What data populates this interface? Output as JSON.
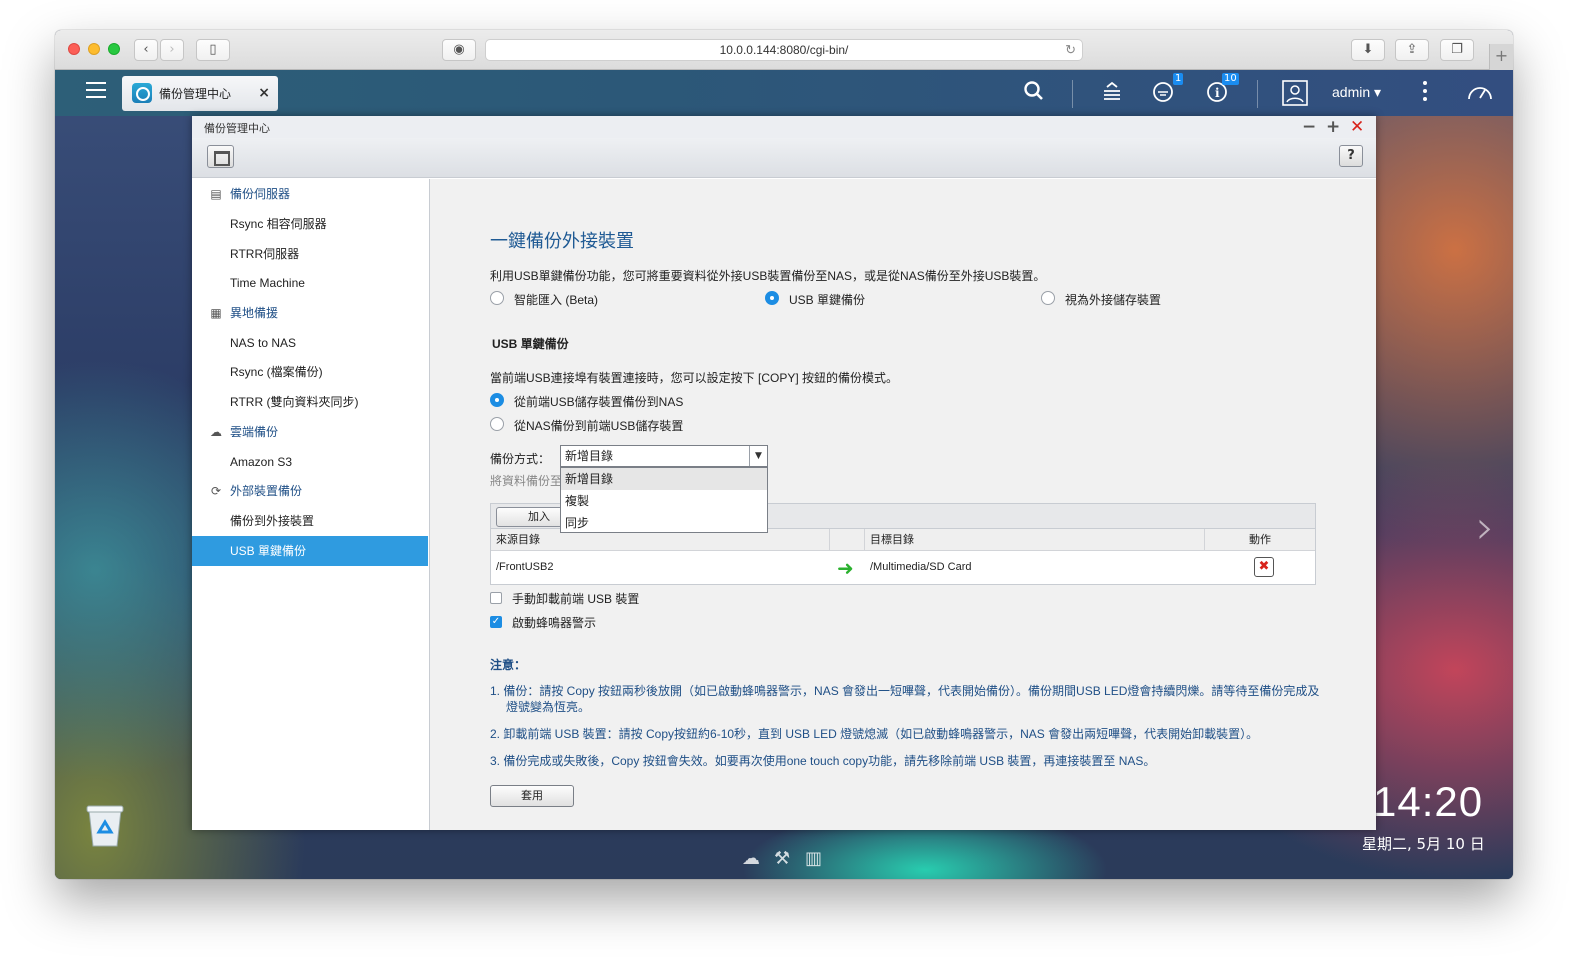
{
  "browser": {
    "url": "10.0.0.144:8080/cgi-bin/"
  },
  "topbar": {
    "app_tab_label": "備份管理中心",
    "notifications_badge": "1",
    "info_badge": "10",
    "user": "admin ▾"
  },
  "window": {
    "title": "備份管理中心",
    "help": "?"
  },
  "sidebar": {
    "groups": [
      {
        "label": "備份伺服器",
        "icon": "server-icon"
      },
      {
        "label": "異地備援",
        "icon": "building-icon"
      },
      {
        "label": "雲端備份",
        "icon": "cloud-icon"
      },
      {
        "label": "外部裝置備份",
        "icon": "sync-icon"
      }
    ],
    "items": [
      {
        "label": "Rsync 相容伺服器"
      },
      {
        "label": "RTRR伺服器"
      },
      {
        "label": "Time Machine"
      },
      {
        "label": "NAS to NAS"
      },
      {
        "label": "Rsync (檔案備份)"
      },
      {
        "label": "RTRR (雙向資料夾同步)"
      },
      {
        "label": "Amazon S3"
      },
      {
        "label": "備份到外接裝置"
      },
      {
        "label": "USB 單鍵備份"
      }
    ]
  },
  "main": {
    "title": "一鍵備份外接裝置",
    "intro": "利用USB單鍵備份功能，您可將重要資料從外接USB裝置備份至NAS，或是從NAS備份至外接USB裝置。",
    "mode_options": [
      "智能匯入 (Beta)",
      "USB 單鍵備份",
      "視為外接儲存裝置"
    ],
    "section_title": "USB 單鍵備份",
    "section_desc": "當前端USB連接埠有裝置連接時，您可以設定按下 [COPY] 按鈕的備份模式。",
    "direction_options": [
      "從前端USB儲存裝置備份到NAS",
      "從NAS備份到前端USB儲存裝置"
    ],
    "method_label": "備份方式：",
    "method_value": "新增目錄",
    "method_options": [
      "新增目錄",
      "複製",
      "同步"
    ],
    "dest_hint": "將資料備份至",
    "add_button": "加入",
    "table": {
      "headers": [
        "來源目錄",
        "目標目錄",
        "動作"
      ],
      "rows": [
        {
          "source": "/FrontUSB2",
          "target": "/Multimedia/SD Card"
        }
      ]
    },
    "checkboxes": [
      {
        "label": "手動卸載前端 USB 裝置",
        "checked": false
      },
      {
        "label": "啟動蜂鳴器警示",
        "checked": true
      }
    ],
    "notes_title": "注意：",
    "notes": [
      "1. 備份：請按 Copy 按鈕兩秒後放開（如已啟動蜂鳴器警示，NAS 會發出一短嗶聲，代表開始備份）。備份期間USB LED燈會持續閃爍。請等待至備份完成及",
      "燈號變為恆亮。",
      "2. 卸載前端 USB 裝置：請按 Copy按鈕約6-10秒，直到 USB LED 燈號熄滅（如已啟動蜂鳴器警示，NAS 會發出兩短嗶聲，代表開始卸載裝置）。",
      "3. 備份完成或失敗後，Copy 按鈕會失效。如要再次使用one touch copy功能，請先移除前端 USB 裝置，再連接裝置至 NAS。"
    ],
    "apply_button": "套用"
  },
  "desktop": {
    "time": "14:20",
    "date": "星期二, 5月 10 日"
  }
}
